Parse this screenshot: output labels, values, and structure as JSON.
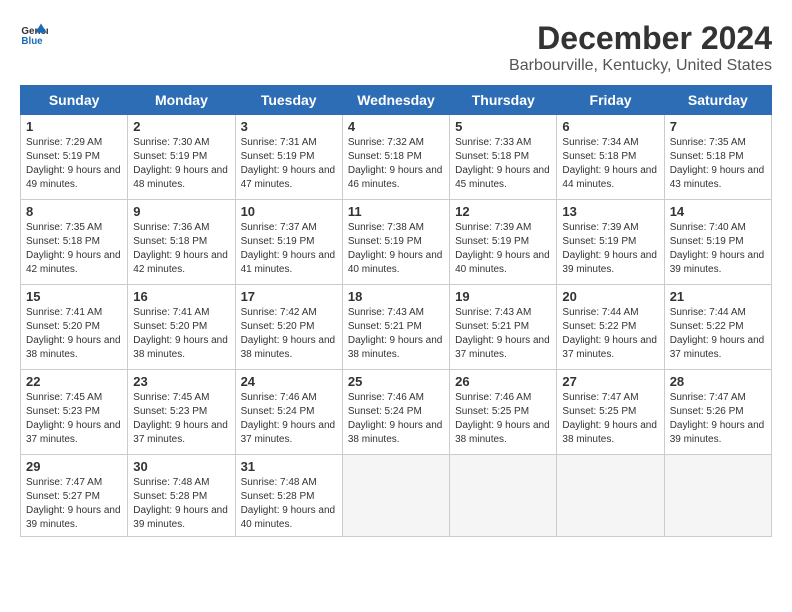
{
  "header": {
    "logo_general": "General",
    "logo_blue": "Blue",
    "title": "December 2024",
    "subtitle": "Barbourville, Kentucky, United States"
  },
  "calendar": {
    "days_of_week": [
      "Sunday",
      "Monday",
      "Tuesday",
      "Wednesday",
      "Thursday",
      "Friday",
      "Saturday"
    ],
    "weeks": [
      [
        {
          "date": "",
          "empty": true
        },
        {
          "date": "",
          "empty": true
        },
        {
          "date": "",
          "empty": true
        },
        {
          "date": "",
          "empty": true
        },
        {
          "date": "",
          "empty": true
        },
        {
          "date": "",
          "empty": true
        },
        {
          "date": "",
          "empty": true
        }
      ],
      [
        {
          "date": "1",
          "sunrise": "7:29 AM",
          "sunset": "5:19 PM",
          "daylight": "9 hours and 49 minutes."
        },
        {
          "date": "2",
          "sunrise": "7:30 AM",
          "sunset": "5:19 PM",
          "daylight": "9 hours and 48 minutes."
        },
        {
          "date": "3",
          "sunrise": "7:31 AM",
          "sunset": "5:19 PM",
          "daylight": "9 hours and 47 minutes."
        },
        {
          "date": "4",
          "sunrise": "7:32 AM",
          "sunset": "5:18 PM",
          "daylight": "9 hours and 46 minutes."
        },
        {
          "date": "5",
          "sunrise": "7:33 AM",
          "sunset": "5:18 PM",
          "daylight": "9 hours and 45 minutes."
        },
        {
          "date": "6",
          "sunrise": "7:34 AM",
          "sunset": "5:18 PM",
          "daylight": "9 hours and 44 minutes."
        },
        {
          "date": "7",
          "sunrise": "7:35 AM",
          "sunset": "5:18 PM",
          "daylight": "9 hours and 43 minutes."
        }
      ],
      [
        {
          "date": "8",
          "sunrise": "7:35 AM",
          "sunset": "5:18 PM",
          "daylight": "9 hours and 42 minutes."
        },
        {
          "date": "9",
          "sunrise": "7:36 AM",
          "sunset": "5:18 PM",
          "daylight": "9 hours and 42 minutes."
        },
        {
          "date": "10",
          "sunrise": "7:37 AM",
          "sunset": "5:19 PM",
          "daylight": "9 hours and 41 minutes."
        },
        {
          "date": "11",
          "sunrise": "7:38 AM",
          "sunset": "5:19 PM",
          "daylight": "9 hours and 40 minutes."
        },
        {
          "date": "12",
          "sunrise": "7:39 AM",
          "sunset": "5:19 PM",
          "daylight": "9 hours and 40 minutes."
        },
        {
          "date": "13",
          "sunrise": "7:39 AM",
          "sunset": "5:19 PM",
          "daylight": "9 hours and 39 minutes."
        },
        {
          "date": "14",
          "sunrise": "7:40 AM",
          "sunset": "5:19 PM",
          "daylight": "9 hours and 39 minutes."
        }
      ],
      [
        {
          "date": "15",
          "sunrise": "7:41 AM",
          "sunset": "5:20 PM",
          "daylight": "9 hours and 38 minutes."
        },
        {
          "date": "16",
          "sunrise": "7:41 AM",
          "sunset": "5:20 PM",
          "daylight": "9 hours and 38 minutes."
        },
        {
          "date": "17",
          "sunrise": "7:42 AM",
          "sunset": "5:20 PM",
          "daylight": "9 hours and 38 minutes."
        },
        {
          "date": "18",
          "sunrise": "7:43 AM",
          "sunset": "5:21 PM",
          "daylight": "9 hours and 38 minutes."
        },
        {
          "date": "19",
          "sunrise": "7:43 AM",
          "sunset": "5:21 PM",
          "daylight": "9 hours and 37 minutes."
        },
        {
          "date": "20",
          "sunrise": "7:44 AM",
          "sunset": "5:22 PM",
          "daylight": "9 hours and 37 minutes."
        },
        {
          "date": "21",
          "sunrise": "7:44 AM",
          "sunset": "5:22 PM",
          "daylight": "9 hours and 37 minutes."
        }
      ],
      [
        {
          "date": "22",
          "sunrise": "7:45 AM",
          "sunset": "5:23 PM",
          "daylight": "9 hours and 37 minutes."
        },
        {
          "date": "23",
          "sunrise": "7:45 AM",
          "sunset": "5:23 PM",
          "daylight": "9 hours and 37 minutes."
        },
        {
          "date": "24",
          "sunrise": "7:46 AM",
          "sunset": "5:24 PM",
          "daylight": "9 hours and 37 minutes."
        },
        {
          "date": "25",
          "sunrise": "7:46 AM",
          "sunset": "5:24 PM",
          "daylight": "9 hours and 38 minutes."
        },
        {
          "date": "26",
          "sunrise": "7:46 AM",
          "sunset": "5:25 PM",
          "daylight": "9 hours and 38 minutes."
        },
        {
          "date": "27",
          "sunrise": "7:47 AM",
          "sunset": "5:25 PM",
          "daylight": "9 hours and 38 minutes."
        },
        {
          "date": "28",
          "sunrise": "7:47 AM",
          "sunset": "5:26 PM",
          "daylight": "9 hours and 39 minutes."
        }
      ],
      [
        {
          "date": "29",
          "sunrise": "7:47 AM",
          "sunset": "5:27 PM",
          "daylight": "9 hours and 39 minutes."
        },
        {
          "date": "30",
          "sunrise": "7:48 AM",
          "sunset": "5:28 PM",
          "daylight": "9 hours and 39 minutes."
        },
        {
          "date": "31",
          "sunrise": "7:48 AM",
          "sunset": "5:28 PM",
          "daylight": "9 hours and 40 minutes."
        },
        {
          "date": "",
          "empty": true
        },
        {
          "date": "",
          "empty": true
        },
        {
          "date": "",
          "empty": true
        },
        {
          "date": "",
          "empty": true
        }
      ]
    ]
  }
}
